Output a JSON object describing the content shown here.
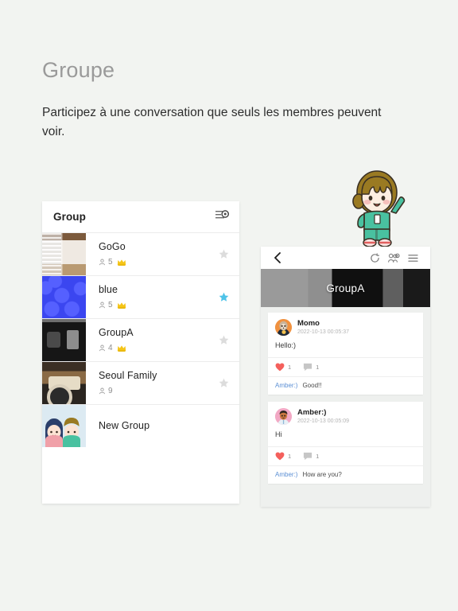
{
  "intro": {
    "title": "Groupe",
    "subtitle": "Participez à une conversation que seuls les membres peuvent voir."
  },
  "colors": {
    "page_background": "#f2f4f1",
    "panel_background": "#ffffff",
    "star_active": "#4fc3e8",
    "star_inactive": "#dcdcdc",
    "crown": "#f5c518",
    "heart": "#f4605c",
    "comment_link": "#5b8fd4",
    "title_grey": "#9a9a9a"
  },
  "group_list": {
    "header": {
      "title": "Group",
      "filter_icon": "filter-settings-icon"
    },
    "rows": [
      {
        "name": "GoGo",
        "member_icon": "person-icon",
        "member_count": "5",
        "has_crown": true,
        "crown_icon": "crown-icon",
        "starred": false,
        "star_icon": "star-icon",
        "thumb": "room-photo"
      },
      {
        "name": "blue",
        "member_icon": "person-icon",
        "member_count": "5",
        "has_crown": true,
        "crown_icon": "crown-icon",
        "starred": true,
        "star_icon": "star-icon",
        "thumb": "blue-cloud-pattern"
      },
      {
        "name": "GroupA",
        "member_icon": "person-icon",
        "member_count": "4",
        "has_crown": true,
        "crown_icon": "crown-icon",
        "starred": false,
        "star_icon": "star-icon",
        "thumb": "dark-window-photo"
      },
      {
        "name": "Seoul Family",
        "member_icon": "person-icon",
        "member_count": "9",
        "has_crown": false,
        "crown_icon": "crown-icon",
        "starred": false,
        "star_icon": "star-icon",
        "thumb": "vintage-camera-photo"
      },
      {
        "name": "New Group",
        "member_icon": "person-icon",
        "member_count": "",
        "has_crown": false,
        "crown_icon": "crown-icon",
        "starred": false,
        "star_icon": "star-icon",
        "thumb": "two-kids-avatar"
      }
    ]
  },
  "group_feed": {
    "toolbar": {
      "back_icon": "back-chevron-icon",
      "refresh_icon": "refresh-icon",
      "members_icon": "manage-members-icon",
      "menu_icon": "hamburger-menu-icon"
    },
    "banner_title": "GroupA",
    "posts": [
      {
        "avatar": "momo-avatar",
        "author": "Momo",
        "timestamp": "2022-10-13 00:05:37",
        "body": "Hello:)",
        "like_icon": "heart-icon",
        "like_count": "1",
        "comment_icon": "speech-bubble-icon",
        "comment_count": "1",
        "comment_author": "Amber:)",
        "comment_text": "Good!!"
      },
      {
        "avatar": "amber-avatar",
        "author": "Amber:)",
        "timestamp": "2022-10-13 00:05:09",
        "body": "Hi",
        "like_icon": "heart-icon",
        "like_count": "1",
        "comment_icon": "speech-bubble-icon",
        "comment_count": "1",
        "comment_author": "Amber:)",
        "comment_text": "How are you?"
      }
    ]
  },
  "mascot": {
    "icon": "waving-girl-illustration"
  }
}
